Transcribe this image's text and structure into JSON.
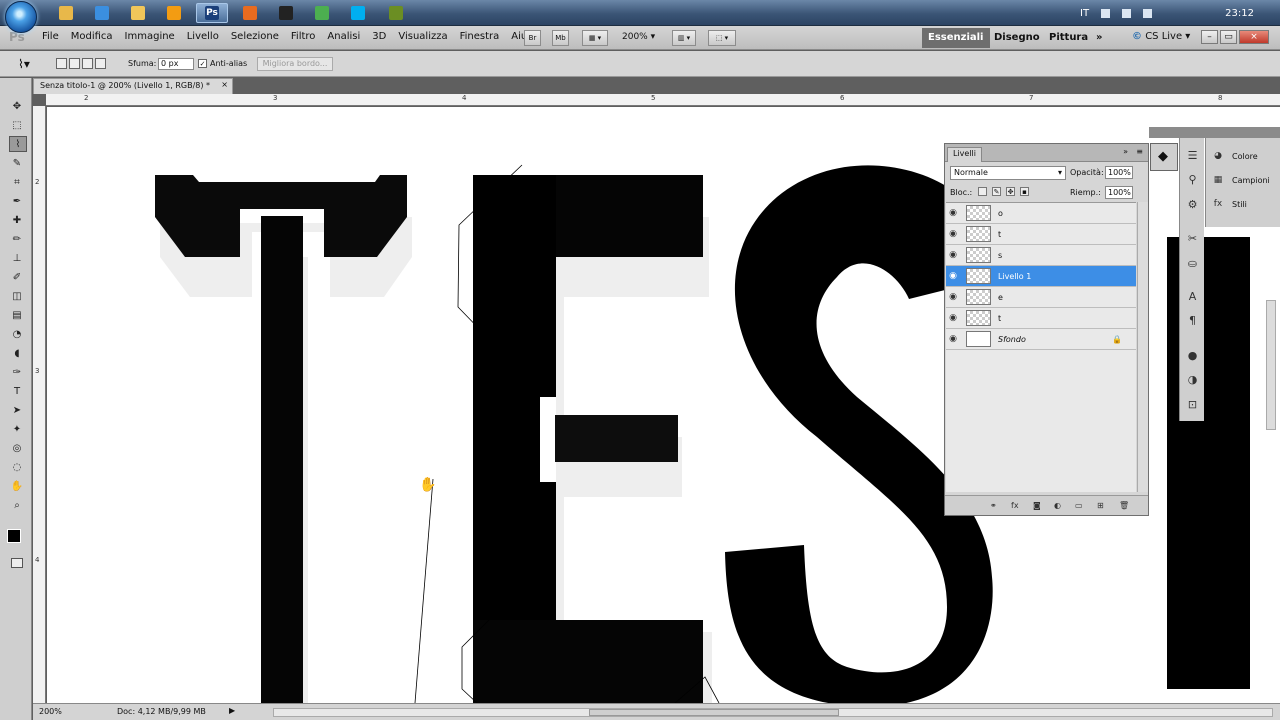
{
  "taskbar": {
    "language": "IT",
    "clock": "23:12",
    "apps": [
      {
        "icon": "folder-icon",
        "color": "#e8b84a"
      },
      {
        "icon": "internet-explorer-icon",
        "color": "#3b8fe0"
      },
      {
        "icon": "explorer-icon",
        "color": "#f0c65a"
      },
      {
        "icon": "media-player-icon",
        "color": "#f39c12"
      },
      {
        "icon": "photoshop-icon",
        "color": "#1a3f7a",
        "label": "Ps"
      },
      {
        "icon": "firefox-icon",
        "color": "#e86b1f"
      },
      {
        "icon": "terminal-icon",
        "color": "#222222"
      },
      {
        "icon": "chrome-icon",
        "color": "#4caf50"
      },
      {
        "icon": "skype-icon",
        "color": "#00aff0"
      },
      {
        "icon": "app-icon",
        "color": "#6b8e23"
      }
    ]
  },
  "appbar": {
    "logo": "Ps",
    "menu": [
      "File",
      "Modifica",
      "Immagine",
      "Livello",
      "Selezione",
      "Filtro",
      "Analisi",
      "3D",
      "Visualizza",
      "Finestra",
      "Aiuto"
    ],
    "br_button": "Br",
    "mb_button": "Mb",
    "zoom_level": "200%",
    "workspaces": {
      "essentials": "Essenziali",
      "design": "Disegno",
      "painting": "Pittura"
    },
    "more": "»",
    "cs_live": "CS Live"
  },
  "options": {
    "feather_label": "Sfuma:",
    "feather_value": "0 px",
    "antialias_label": "Anti-alias",
    "antialias_check": "✓",
    "refine_edge": "Migliora bordo..."
  },
  "document": {
    "tab_title": "Senza titolo-1 @ 200% (Livello 1, RGB/8) *",
    "close": "×",
    "ruler_top": [
      "2",
      "3",
      "4",
      "5",
      "6",
      "7",
      "8"
    ],
    "ruler_left": [
      "2",
      "3",
      "4"
    ]
  },
  "status": {
    "zoom": "200%",
    "doc_size": "Doc: 4,12 MB/9,99 MB"
  },
  "layers_panel": {
    "tab": "Livelli",
    "blend_mode": "Normale",
    "opacity_label": "Opacità:",
    "opacity": "100%",
    "lock_label": "Bloc.:",
    "fill_label": "Riemp.:",
    "fill": "100%",
    "layers": [
      {
        "name": "o",
        "selected": false,
        "italic": false,
        "locked": false
      },
      {
        "name": "t",
        "selected": false,
        "italic": false,
        "locked": false
      },
      {
        "name": "s",
        "selected": false,
        "italic": false,
        "locked": false
      },
      {
        "name": "Livello 1",
        "selected": true,
        "italic": false,
        "locked": false
      },
      {
        "name": "e",
        "selected": false,
        "italic": false,
        "locked": false
      },
      {
        "name": "t",
        "selected": false,
        "italic": false,
        "locked": false
      },
      {
        "name": "Sfondo",
        "selected": false,
        "italic": true,
        "locked": true
      }
    ]
  },
  "dock": {
    "panels": [
      "Colore",
      "Campioni",
      "Stili"
    ]
  }
}
